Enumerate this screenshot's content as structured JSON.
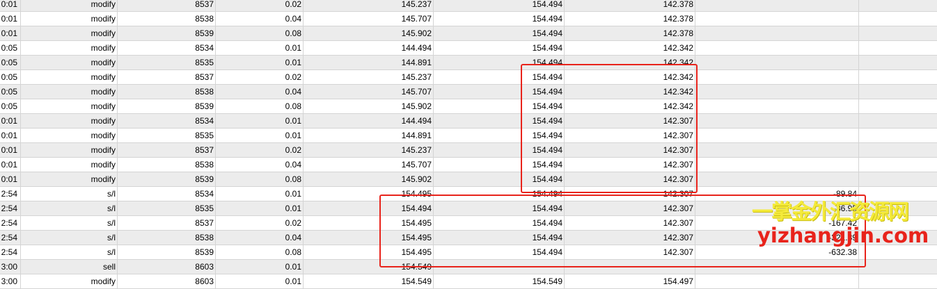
{
  "watermark": {
    "line1": "一掌金外汇资源网",
    "line2": "yizhangjin.com"
  },
  "rows": [
    [
      "0:01",
      "modify",
      "8537",
      "0.02",
      "145.237",
      "154.494",
      "142.378",
      "",
      ""
    ],
    [
      "0:01",
      "modify",
      "8538",
      "0.04",
      "145.707",
      "154.494",
      "142.378",
      "",
      ""
    ],
    [
      "0:01",
      "modify",
      "8539",
      "0.08",
      "145.902",
      "154.494",
      "142.378",
      "",
      ""
    ],
    [
      "0:05",
      "modify",
      "8534",
      "0.01",
      "144.494",
      "154.494",
      "142.342",
      "",
      ""
    ],
    [
      "0:05",
      "modify",
      "8535",
      "0.01",
      "144.891",
      "154.494",
      "142.342",
      "",
      ""
    ],
    [
      "0:05",
      "modify",
      "8537",
      "0.02",
      "145.237",
      "154.494",
      "142.342",
      "",
      ""
    ],
    [
      "0:05",
      "modify",
      "8538",
      "0.04",
      "145.707",
      "154.494",
      "142.342",
      "",
      ""
    ],
    [
      "0:05",
      "modify",
      "8539",
      "0.08",
      "145.902",
      "154.494",
      "142.342",
      "",
      ""
    ],
    [
      "0:01",
      "modify",
      "8534",
      "0.01",
      "144.494",
      "154.494",
      "142.307",
      "",
      ""
    ],
    [
      "0:01",
      "modify",
      "8535",
      "0.01",
      "144.891",
      "154.494",
      "142.307",
      "",
      ""
    ],
    [
      "0:01",
      "modify",
      "8537",
      "0.02",
      "145.237",
      "154.494",
      "142.307",
      "",
      ""
    ],
    [
      "0:01",
      "modify",
      "8538",
      "0.04",
      "145.707",
      "154.494",
      "142.307",
      "",
      ""
    ],
    [
      "0:01",
      "modify",
      "8539",
      "0.08",
      "145.902",
      "154.494",
      "142.307",
      "",
      ""
    ],
    [
      "2:54",
      "s/l",
      "8534",
      "0.01",
      "154.495",
      "154.494",
      "142.307",
      "-89.84",
      ""
    ],
    [
      "2:54",
      "s/l",
      "8535",
      "0.01",
      "154.494",
      "154.494",
      "142.307",
      "-86.95",
      ""
    ],
    [
      "2:54",
      "s/l",
      "8537",
      "0.02",
      "154.495",
      "154.494",
      "142.307",
      "-167.42",
      ""
    ],
    [
      "2:54",
      "s/l",
      "8538",
      "0.04",
      "154.495",
      "154.494",
      "142.307",
      "-321.39",
      ""
    ],
    [
      "2:54",
      "s/l",
      "8539",
      "0.08",
      "154.495",
      "154.494",
      "142.307",
      "-632.38",
      ""
    ],
    [
      "3:00",
      "sell",
      "8603",
      "0.01",
      "154.549",
      "",
      "",
      "",
      ""
    ],
    [
      "3:00",
      "modify",
      "8603",
      "0.01",
      "154.549",
      "154.549",
      "154.497",
      "",
      ""
    ]
  ]
}
